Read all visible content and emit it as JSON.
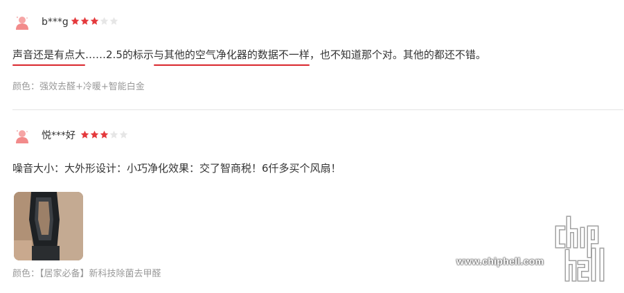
{
  "reviews": [
    {
      "username": "b***g",
      "rating": 3,
      "max_rating": 5,
      "comment_parts": [
        {
          "text": "声音还是有点大",
          "highlight": true
        },
        {
          "text": "……2.5的标示",
          "highlight": false
        },
        {
          "text": "与其他的空气净化器的数据不一样",
          "highlight": true
        },
        {
          "text": "，也不知道那个对。其他的都还不错。",
          "highlight": false
        }
      ],
      "variant": "颜色：强效去醛+冷暖+智能白金"
    },
    {
      "username": "悦***好",
      "rating": 3,
      "max_rating": 5,
      "comment_parts": [
        {
          "text": "噪音大小：大外形设计：小巧净化效果：交了智商税！6仟多买个风扇！",
          "highlight": false
        }
      ],
      "variant": "颜色：【居家必备】新科技除菌去甲醛"
    }
  ],
  "watermark": {
    "url": "www.chiphell.com",
    "logo_icon": "chiphell-logo-icon"
  },
  "colors": {
    "star_filled": "#e4393c",
    "star_empty": "#e6e6e6",
    "highlight_underline": "#d9262c",
    "avatar": "#f28b8b"
  }
}
